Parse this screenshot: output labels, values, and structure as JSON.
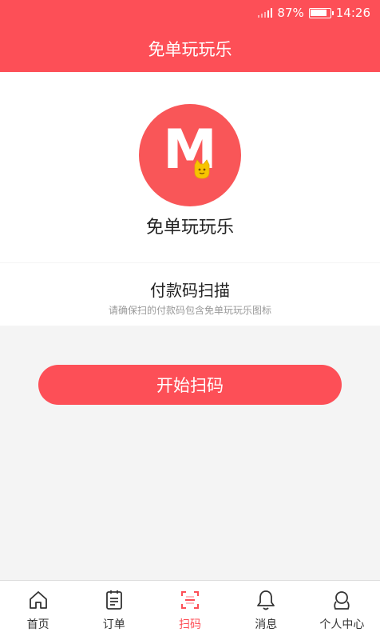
{
  "status_bar": {
    "battery": "87%",
    "time": "14:26"
  },
  "header": {
    "title": "免单玩玩乐"
  },
  "logo": {
    "letter": "M",
    "app_name": "免单玩玩乐"
  },
  "scan": {
    "title": "付款码扫描",
    "hint": "请确保扫的付款码包含免单玩玩乐图标"
  },
  "button": {
    "start": "开始扫码"
  },
  "tabs": [
    {
      "label": "首页",
      "icon": "home-icon"
    },
    {
      "label": "订单",
      "icon": "order-icon"
    },
    {
      "label": "扫码",
      "icon": "scan-icon"
    },
    {
      "label": "消息",
      "icon": "bell-icon"
    },
    {
      "label": "个人中心",
      "icon": "user-icon"
    }
  ],
  "colors": {
    "primary": "#fd4f57",
    "logo_bg": "#f95658"
  }
}
